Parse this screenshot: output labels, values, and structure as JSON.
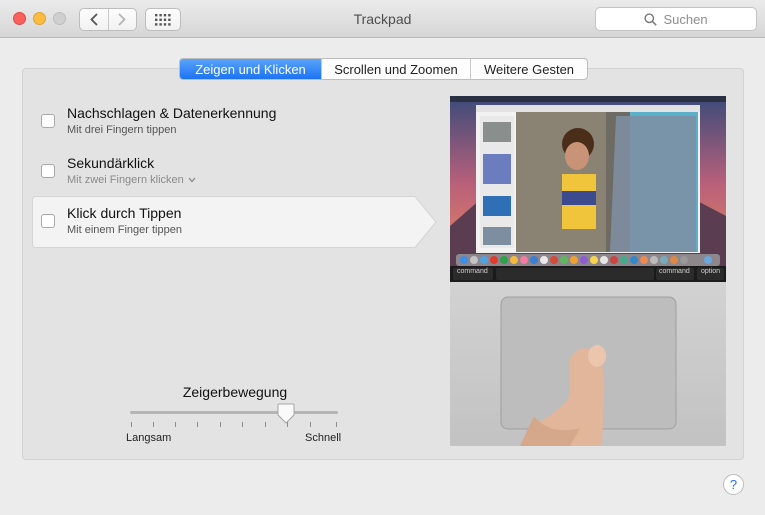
{
  "window": {
    "title": "Trackpad",
    "search_placeholder": "Suchen"
  },
  "tabs": [
    {
      "label": "Zeigen und Klicken",
      "active": true
    },
    {
      "label": "Scrollen und Zoomen",
      "active": false
    },
    {
      "label": "Weitere Gesten",
      "active": false
    }
  ],
  "options": [
    {
      "title": "Nachschlagen & Datenerkennung",
      "subtitle": "Mit drei Fingern tippen",
      "checked": false
    },
    {
      "title": "Sekundärklick",
      "subtitle": "Mit zwei Fingern klicken",
      "checked": false
    },
    {
      "title": "Klick durch Tippen",
      "subtitle": "Mit einem Finger tippen",
      "checked": false
    }
  ],
  "tracking": {
    "title": "Zeigerbewegung",
    "min_label": "Langsam",
    "max_label": "Schnell",
    "value_fraction": 0.75
  },
  "preview": {
    "keyboard_keys": [
      "command",
      "command",
      "option"
    ]
  },
  "help": {
    "label": "?"
  },
  "colors": {
    "accent": "#1b73f5",
    "close": "#fc605c",
    "minimize": "#fdbc40"
  }
}
